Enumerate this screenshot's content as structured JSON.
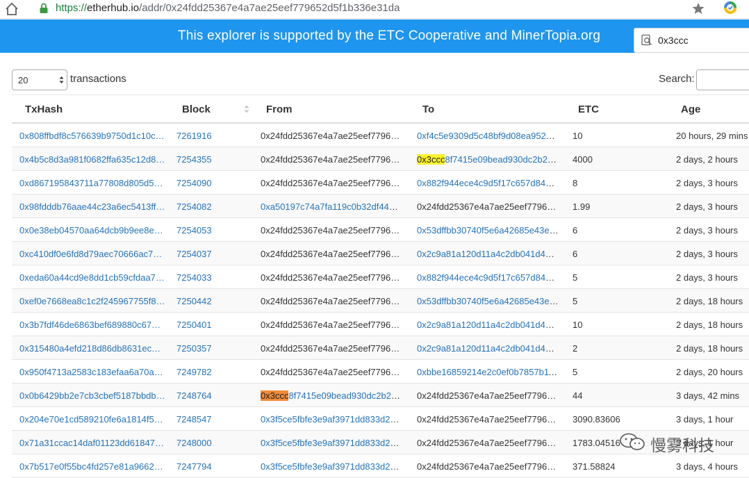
{
  "browser": {
    "url_scheme": "https://",
    "url_host": "etherhub.io",
    "url_path": "/addr/0x24fdd25367e4a7ae25eef779652d5f1b336e31da"
  },
  "banner": {
    "text": "This explorer is supported by the ETC Cooperative and MinerTopia.org",
    "search_value": "0x3ccc"
  },
  "controls": {
    "page_length": "20",
    "length_suffix": "transactions",
    "search_label": "Search:"
  },
  "table": {
    "headers": [
      "TxHash",
      "Block",
      "From",
      "To",
      "ETC",
      "Age"
    ],
    "rows": [
      {
        "hash": "0x808ffbdf8c576639b9750d1c10c8…",
        "block": "7261916",
        "from": "0x24fdd25367e4a7ae25eef779652…",
        "to": "0xf4c5e9309d5c48bf9d08ea9525b…",
        "etc": "10",
        "age": "20 hours, 29 mins"
      },
      {
        "hash": "0x4b5c8d3a981f0682ffa635c12d8a…",
        "block": "7254355",
        "from": "0x24fdd25367e4a7ae25eef779652…",
        "to_hl": "0x3ccc",
        "to": "8f7415e09bead930dc2b236…",
        "etc": "4000",
        "age": "2 days, 2 hours"
      },
      {
        "hash": "0xd867195843711a77808d805d5b…",
        "block": "7254090",
        "from": "0x24fdd25367e4a7ae25eef779652…",
        "to": "0x882f944ece4c9d5f17c657d8448c…",
        "etc": "8",
        "age": "2 days, 3 hours"
      },
      {
        "hash": "0x98fdddb76aae44c23a6ec5413ff0…",
        "block": "7254082",
        "from": "0xa50197c74a7fa119c0b32df445cd…",
        "to": "0x24fdd25367e4a7ae25eef779652…",
        "etc": "1.99",
        "age": "2 days, 3 hours"
      },
      {
        "hash": "0x0e38eb04570aa64dcb9b9ee8e94…",
        "block": "7254053",
        "from": "0x24fdd25367e4a7ae25eef779652…",
        "to": "0x53dffbb30740f5e6a42685e43e8f…",
        "etc": "6",
        "age": "2 days, 3 hours"
      },
      {
        "hash": "0xc410df0e6fd8d79aec70666ac7e1…",
        "block": "7254037",
        "from": "0x24fdd25367e4a7ae25eef779652…",
        "to": "0x2c9a81a120d11a4c2db041d4ec3…",
        "etc": "6",
        "age": "2 days, 3 hours"
      },
      {
        "hash": "0xeda60a44cd9e8dd1cb59cfdaa7c9…",
        "block": "7254033",
        "from": "0x24fdd25367e4a7ae25eef779652…",
        "to": "0x882f944ece4c9d5f17c657d8448c…",
        "etc": "5",
        "age": "2 days, 3 hours"
      },
      {
        "hash": "0xef0e7668ea8c1c2f245967755f81…",
        "block": "7250442",
        "from": "0x24fdd25367e4a7ae25eef779652…",
        "to": "0x53dffbb30740f5e6a42685e43e8f…",
        "etc": "5",
        "age": "2 days, 18 hours"
      },
      {
        "hash": "0x3b7fdf46de6863bef689880c67dd…",
        "block": "7250401",
        "from": "0x24fdd25367e4a7ae25eef779652…",
        "to": "0x2c9a81a120d11a4c2db041d4ec3…",
        "etc": "10",
        "age": "2 days, 18 hours"
      },
      {
        "hash": "0x315480a4efd218d86db8631ec42…",
        "block": "7250357",
        "from": "0x24fdd25367e4a7ae25eef779652…",
        "to": "0x2c9a81a120d11a4c2db041d4ec3…",
        "etc": "2",
        "age": "2 days, 18 hours"
      },
      {
        "hash": "0x950f4713a2583c183efaa6a70a1d…",
        "block": "7249782",
        "from": "0x24fdd25367e4a7ae25eef779652…",
        "to": "0xbbe16859214e2c0ef0b7857b11f…",
        "etc": "5",
        "age": "2 days, 20 hours"
      },
      {
        "hash": "0x0b6429bb2e7cb3cbef5187bbdb4…",
        "block": "7248764",
        "from_hl": "0x3ccc",
        "from": "8f7415e09bead930dc2b236…",
        "to": "0x24fdd25367e4a7ae25eef779652…",
        "etc": "44",
        "age": "3 days, 42 mins"
      },
      {
        "hash": "0x204e70e1cd589210fe6a1814f50e…",
        "block": "7248547",
        "from": "0x3f5ce5fbfe3e9af3971dd833d26b…",
        "to": "0x24fdd25367e4a7ae25eef779652…",
        "etc": "3090.83606",
        "age": "3 days, 1 hour"
      },
      {
        "hash": "0x71a31ccac14daf01123dd61847c0…",
        "block": "7248000",
        "from": "0x3f5ce5fbfe3e9af3971dd833d26b…",
        "to": "0x24fdd25367e4a7ae25eef779652…",
        "etc": "1783.04516",
        "age": "3 days, 1 hour"
      },
      {
        "hash": "0x7b517e0f55bc4fd257e81a9662cb…",
        "block": "7247794",
        "from": "0x3f5ce5fbfe3e9af3971dd833d26b…",
        "to": "0x24fdd25367e4a7ae25eef779652…",
        "etc": "371.58824",
        "age": "3 days, 4 hours"
      }
    ]
  },
  "watermark": {
    "text": "慢雾科技"
  },
  "colors": {
    "banner": "#1e95ef",
    "link": "#2673b8",
    "highlight_yellow": "#fbf22a",
    "highlight_orange": "#f28a37"
  },
  "icons": [
    "home-icon",
    "lock-icon",
    "star-icon",
    "extension-icon",
    "search-icon",
    "sort-icon",
    "wechat-icon"
  ]
}
